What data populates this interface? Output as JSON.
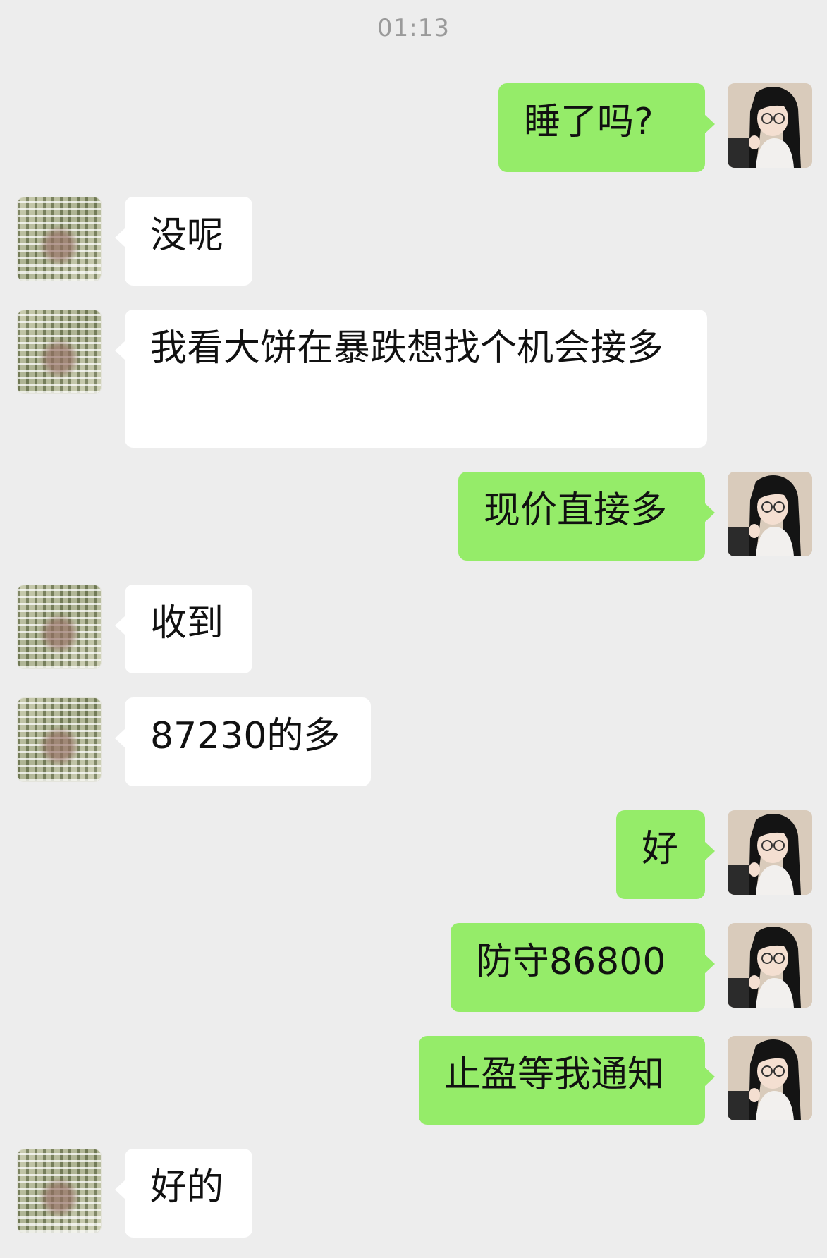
{
  "header": {
    "timestamp": "01:13"
  },
  "colors": {
    "background": "#ededed",
    "outgoing_bubble": "#95ec69",
    "incoming_bubble": "#ffffff",
    "timestamp_text": "#9a9a9a"
  },
  "contact_avatar_icon": "mosaic-avatar-icon",
  "self_avatar_icon": "anime-girl-avatar-icon",
  "messages": [
    {
      "side": "right",
      "text": "睡了吗?"
    },
    {
      "side": "left",
      "text": "没呢"
    },
    {
      "side": "left",
      "text": "我看大饼在暴跌想找个机会接多"
    },
    {
      "side": "right",
      "text": "现价直接多"
    },
    {
      "side": "left",
      "text": "收到"
    },
    {
      "side": "left",
      "text": "87230的多"
    },
    {
      "side": "right",
      "text": "好"
    },
    {
      "side": "right",
      "text": "防守86800"
    },
    {
      "side": "right",
      "text": "止盈等我通知"
    },
    {
      "side": "left",
      "text": "好的"
    }
  ]
}
